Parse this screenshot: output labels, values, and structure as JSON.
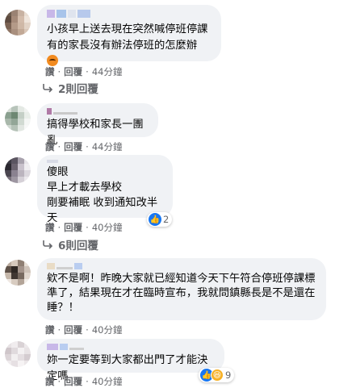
{
  "comments": [
    {
      "lines": [
        "小孩早上送去現在突然喊停班停課",
        "有的家長沒有辦法停班的怎麼辦"
      ],
      "emoji": "angry-face-icon",
      "actions": {
        "like": "讚",
        "reply": "回覆",
        "time": "44分鐘"
      },
      "replies_label": "2則回覆"
    },
    {
      "lines": [
        "搞得學校和家長一團亂"
      ],
      "actions": {
        "like": "讚",
        "reply": "回覆",
        "time": "44分鐘"
      }
    },
    {
      "lines": [
        "傻眼",
        "早上才載去學校",
        "剛要補眠 收到通知改半天"
      ],
      "actions": {
        "like": "讚",
        "reply": "回覆",
        "time": "40分鐘"
      },
      "reactions": {
        "icons": [
          "like-icon"
        ],
        "count": "2"
      },
      "replies_label": "6則回覆"
    },
    {
      "lines": [
        "欸不是啊！昨晚大家就已經知道今天下午符合停班停課標",
        "準了，結果現在才在臨時宣布，我就問鎮縣長是不是還在",
        "睡？！"
      ],
      "actions": {
        "like": "讚",
        "reply": "回覆",
        "time": "40分鐘"
      }
    },
    {
      "lines": [
        "妳一定要等到大家都出門了才能決定嗎"
      ],
      "actions": {
        "like": "讚",
        "reply": "回覆",
        "time": "40分鐘"
      },
      "reactions": {
        "icons": [
          "like-icon",
          "haha-icon"
        ],
        "count": "9"
      }
    }
  ],
  "colors": {
    "bubble": "#f0f2f5",
    "meta_text": "#65676b",
    "like_blue": "#1877f2"
  }
}
